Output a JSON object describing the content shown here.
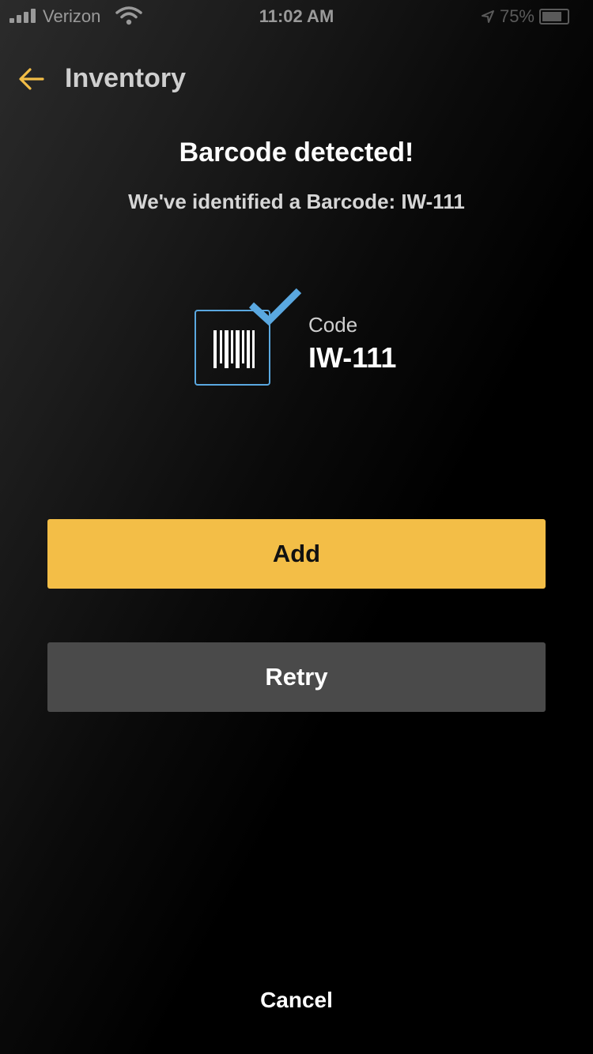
{
  "status_bar": {
    "carrier": "Verizon",
    "time": "11:02 AM",
    "battery": "75%",
    "signal_bars": 4
  },
  "nav": {
    "title": "Inventory",
    "back_icon": "arrow-left-icon"
  },
  "result": {
    "heading": "Barcode detected!",
    "message": "We've identified a Barcode: IW-111",
    "code_label": "Code",
    "code_value": "IW-111",
    "barcode_icon": "barcode-icon",
    "check_icon": "checkmark-icon"
  },
  "actions": {
    "add_label": "Add",
    "retry_label": "Retry",
    "cancel_label": "Cancel"
  },
  "colors": {
    "accent": "#f3be47",
    "check": "#5aa8e0",
    "secondary_button": "#4a4a4a"
  }
}
